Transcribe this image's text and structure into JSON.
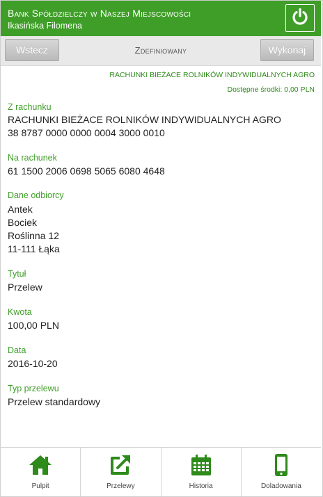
{
  "header": {
    "bank_name": "Bank Spółdzielczy w Naszej Miejscowości",
    "user_name": "Ikasińska Filomena",
    "icon": "power-icon",
    "accent_color": "#3f9e28"
  },
  "toolbar": {
    "back_label": "Wstecz",
    "title": "Zdefiniowany",
    "execute_label": "Wykonaj"
  },
  "account_info": {
    "account_type": "RACHUNKI BIEŻACE ROLNIKÓW INDYWIDUALNYCH AGRO",
    "available_funds": "Dostępne środki: 0,00 PLN"
  },
  "details": {
    "from_account": {
      "label": "Z rachunku",
      "name": "RACHUNKI BIEŻACE ROLNIKÓW INDYWIDUALNYCH AGRO",
      "number": "38 8787 0000 0000 0004 3000 0010"
    },
    "to_account": {
      "label": "Na rachunek",
      "number": "61 1500 2006 0698 5065 6080 4648"
    },
    "recipient": {
      "label": "Dane odbiorcy",
      "lines": [
        "Antek",
        "Bociek",
        "Roślinna 12",
        "11-111 Łąka"
      ]
    },
    "title": {
      "label": "Tytuł",
      "value": "Przelew"
    },
    "amount": {
      "label": "Kwota",
      "value": "100,00 PLN"
    },
    "date": {
      "label": "Data",
      "value": "2016-10-20"
    },
    "transfer_type": {
      "label": "Typ przelewu",
      "value": "Przelew standardowy"
    }
  },
  "bottom_nav": [
    {
      "label": "Pulpit",
      "icon": "home-icon"
    },
    {
      "label": "Przelewy",
      "icon": "external-link-icon"
    },
    {
      "label": "Historia",
      "icon": "calendar-icon"
    },
    {
      "label": "Doladowania",
      "icon": "mobile-phone-icon"
    }
  ]
}
